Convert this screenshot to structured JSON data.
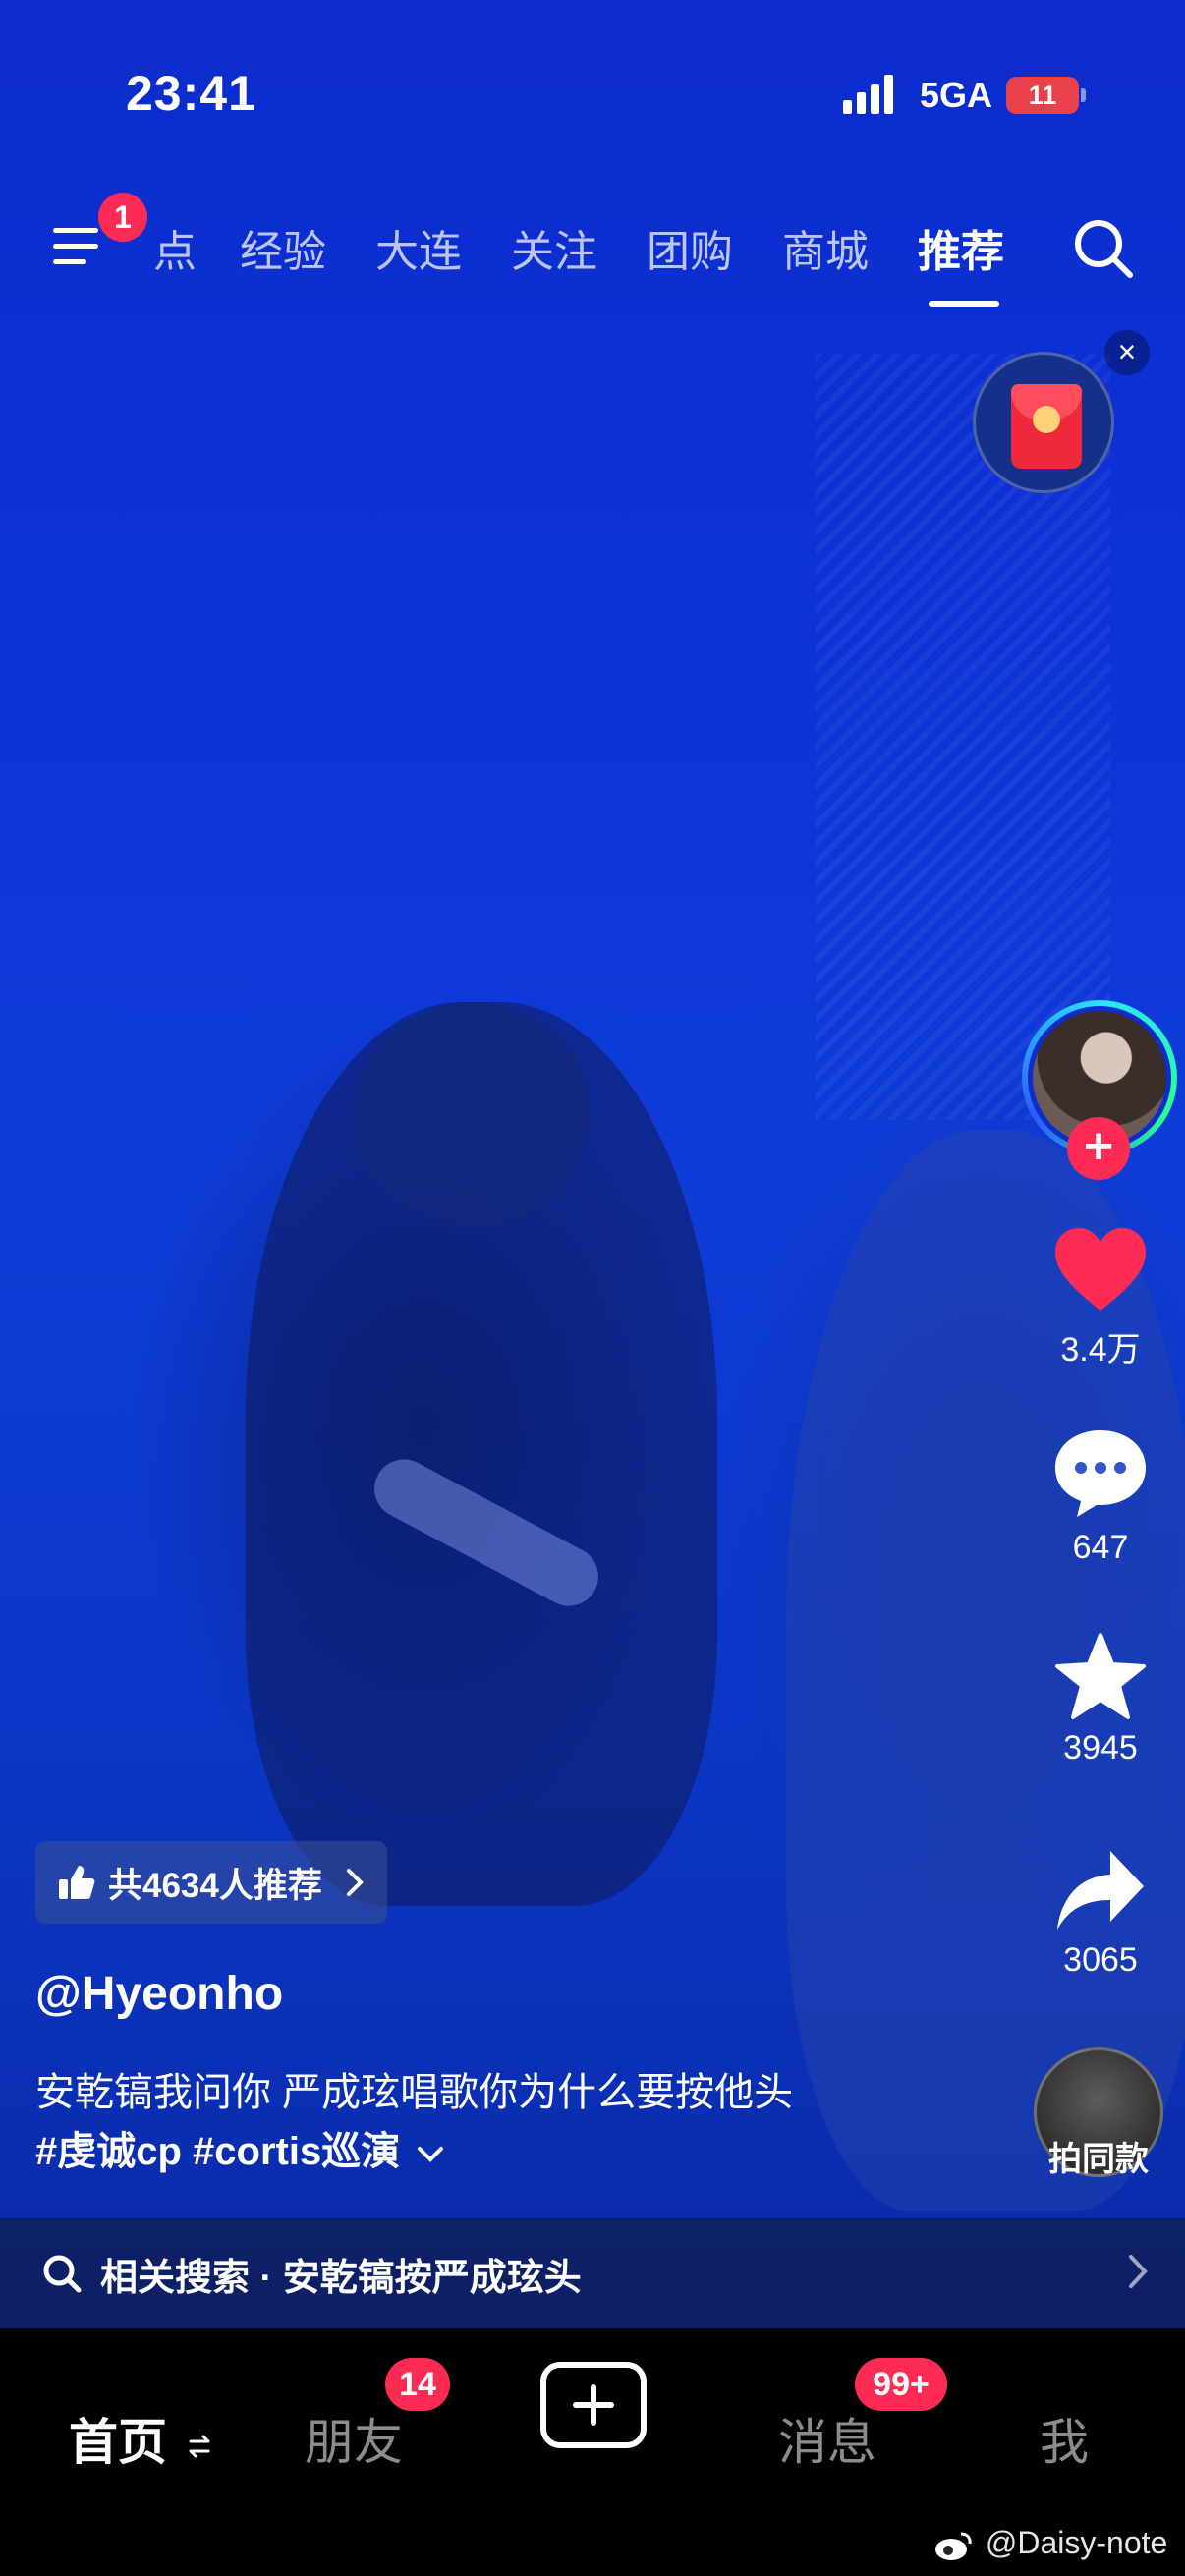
{
  "status_bar": {
    "time": "23:41",
    "network": "5GA",
    "battery": "11"
  },
  "top_nav": {
    "menu_badge": "1",
    "tabs": [
      {
        "label": "点"
      },
      {
        "label": "经验"
      },
      {
        "label": "大连"
      },
      {
        "label": "关注"
      },
      {
        "label": "团购"
      },
      {
        "label": "商城"
      },
      {
        "label": "推荐",
        "active": true
      }
    ]
  },
  "floating": {
    "close": "×"
  },
  "actions": {
    "likes": "3.4万",
    "comments": "647",
    "favorites": "3945",
    "shares": "3065",
    "same_style": "拍同款"
  },
  "video_info": {
    "recommend_pill": "共4634人推荐",
    "author": "@Hyeonho",
    "caption": "安乾镐我问你 严成玹唱歌你为什么要按他头",
    "hashtags": "#虔诚cp #cortis巡演"
  },
  "related_search": {
    "label": "相关搜索 · 安乾镐按严成玹头"
  },
  "bottom_tabs": {
    "home": "首页",
    "friends": "朋友",
    "friends_badge": "14",
    "messages": "消息",
    "messages_badge": "99+",
    "me": "我"
  },
  "watermark": "@Daisy-note",
  "colors": {
    "accent": "#fe2c55",
    "video_bg": "#0d32d6",
    "tabbar_bg": "#000000"
  },
  "icons": [
    "menu-icon",
    "search-icon",
    "red-packet-icon",
    "heart-icon",
    "comment-icon",
    "star-icon",
    "share-icon",
    "thumbs-up-icon",
    "chevron-right-icon",
    "plus-icon",
    "refresh-icon",
    "weibo-icon"
  ]
}
